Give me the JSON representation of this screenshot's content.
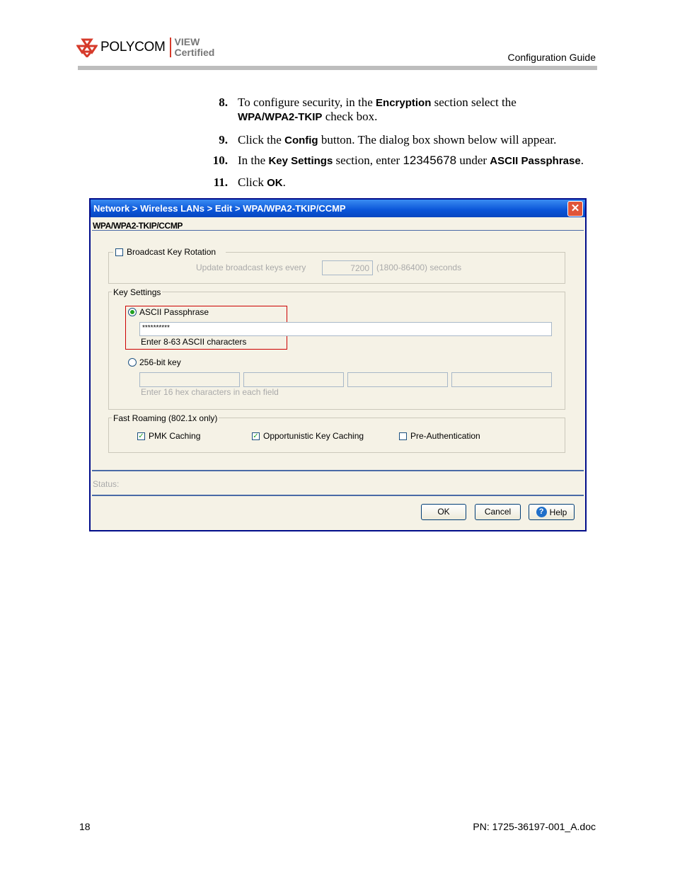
{
  "header": {
    "brand": "POLYCOM",
    "certification_line1": "VIEW",
    "certification_line2": "Certified",
    "doc_title": "Configuration Guide"
  },
  "steps": [
    {
      "num": "8.",
      "parts": [
        "To configure security, in the ",
        "Encryption",
        " section select the ",
        "WPA/WPA2-TKIP",
        " check box."
      ]
    },
    {
      "num": "9.",
      "parts": [
        "Click the ",
        "Config",
        " button. The dialog box shown below will appear."
      ]
    },
    {
      "num": "10.",
      "parts": [
        "In the ",
        "Key Settings",
        " section, enter ",
        "12345678",
        " under ",
        "ASCII Passphrase",
        "."
      ]
    },
    {
      "num": "11.",
      "parts": [
        "Click ",
        "OK",
        "."
      ]
    }
  ],
  "dialog": {
    "breadcrumb": "Network > Wireless LANs > Edit > WPA/WPA2-TKIP/CCMP",
    "close_glyph": "✕",
    "subtitle": "WPA/WPA2-TKIP/CCMP",
    "broadcast": {
      "label": "Broadcast Key Rotation",
      "checked": false,
      "update_label": "Update broadcast keys every",
      "interval_value": "7200",
      "range_label": "(1800-86400) seconds"
    },
    "key_settings": {
      "legend": "Key Settings",
      "ascii_label": "ASCII Passphrase",
      "ascii_selected": true,
      "passphrase_value": "**********",
      "ascii_hint": "Enter 8-63 ASCII characters",
      "hex_label": "256-bit key",
      "hex_selected": false,
      "hex_hint": "Enter 16 hex characters in each field"
    },
    "fast_roaming": {
      "legend": "Fast Roaming (802.1x only)",
      "options": [
        {
          "label": "PMK Caching",
          "checked": true
        },
        {
          "label": "Opportunistic Key Caching",
          "checked": true
        },
        {
          "label": "Pre-Authentication",
          "checked": false
        }
      ]
    },
    "status_label": "Status:",
    "buttons": {
      "ok": "OK",
      "cancel": "Cancel",
      "help": "Help",
      "help_glyph": "?"
    },
    "highlight_color": "#cc0000"
  },
  "footer": {
    "page_number": "18",
    "part_number": "PN: 1725-36197-001_A.doc"
  }
}
